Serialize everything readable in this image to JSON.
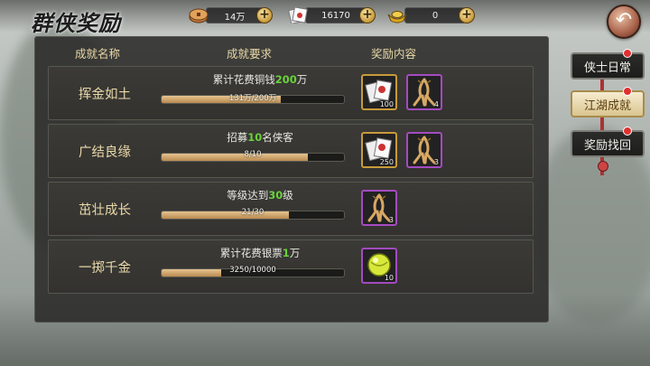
{
  "header": {
    "title": "群侠奖励"
  },
  "currencies": [
    {
      "icon": "copper-coin-icon",
      "value": "14万"
    },
    {
      "icon": "silver-note-icon",
      "value": "16170"
    },
    {
      "icon": "gold-ingot-icon",
      "value": "0"
    }
  ],
  "columns": {
    "name": "成就名称",
    "requirement": "成就要求",
    "rewards": "奖励内容"
  },
  "achievements": [
    {
      "name": "挥金如土",
      "req_prefix": "累计花费铜钱",
      "req_value": "200",
      "req_suffix": "万",
      "progress_text": "131万/200万",
      "progress": 0.655,
      "rewards": [
        {
          "icon": "silver-note-icon",
          "count": "100",
          "frame": "gold"
        },
        {
          "icon": "ginseng-icon",
          "count": "4",
          "frame": "purple"
        }
      ]
    },
    {
      "name": "广结良缘",
      "req_prefix": "招募",
      "req_value": "10",
      "req_suffix": "名侠客",
      "progress_text": "8/10",
      "progress": 0.8,
      "rewards": [
        {
          "icon": "silver-note-icon",
          "count": "250",
          "frame": "gold"
        },
        {
          "icon": "ginseng-icon",
          "count": "3",
          "frame": "purple"
        }
      ]
    },
    {
      "name": "茁壮成长",
      "req_prefix": "等级达到",
      "req_value": "30",
      "req_suffix": "级",
      "progress_text": "21/30",
      "progress": 0.7,
      "rewards": [
        {
          "icon": "ginseng-icon",
          "count": "3",
          "frame": "purple"
        }
      ]
    },
    {
      "name": "一掷千金",
      "req_prefix": "累计花费银票",
      "req_value": "1",
      "req_suffix": "万",
      "progress_text": "3250/10000",
      "progress": 0.325,
      "rewards": [
        {
          "icon": "jade-orb-icon",
          "count": "10",
          "frame": "purple"
        }
      ]
    }
  ],
  "tabs": [
    {
      "label": "侠士日常",
      "active": false
    },
    {
      "label": "江湖成就",
      "active": true
    },
    {
      "label": "奖励找回",
      "active": false
    }
  ],
  "colors": {
    "accent_gold": "#c89a3a",
    "rare_purple": "#a44bc0",
    "highlight_green": "#6ad33a"
  }
}
